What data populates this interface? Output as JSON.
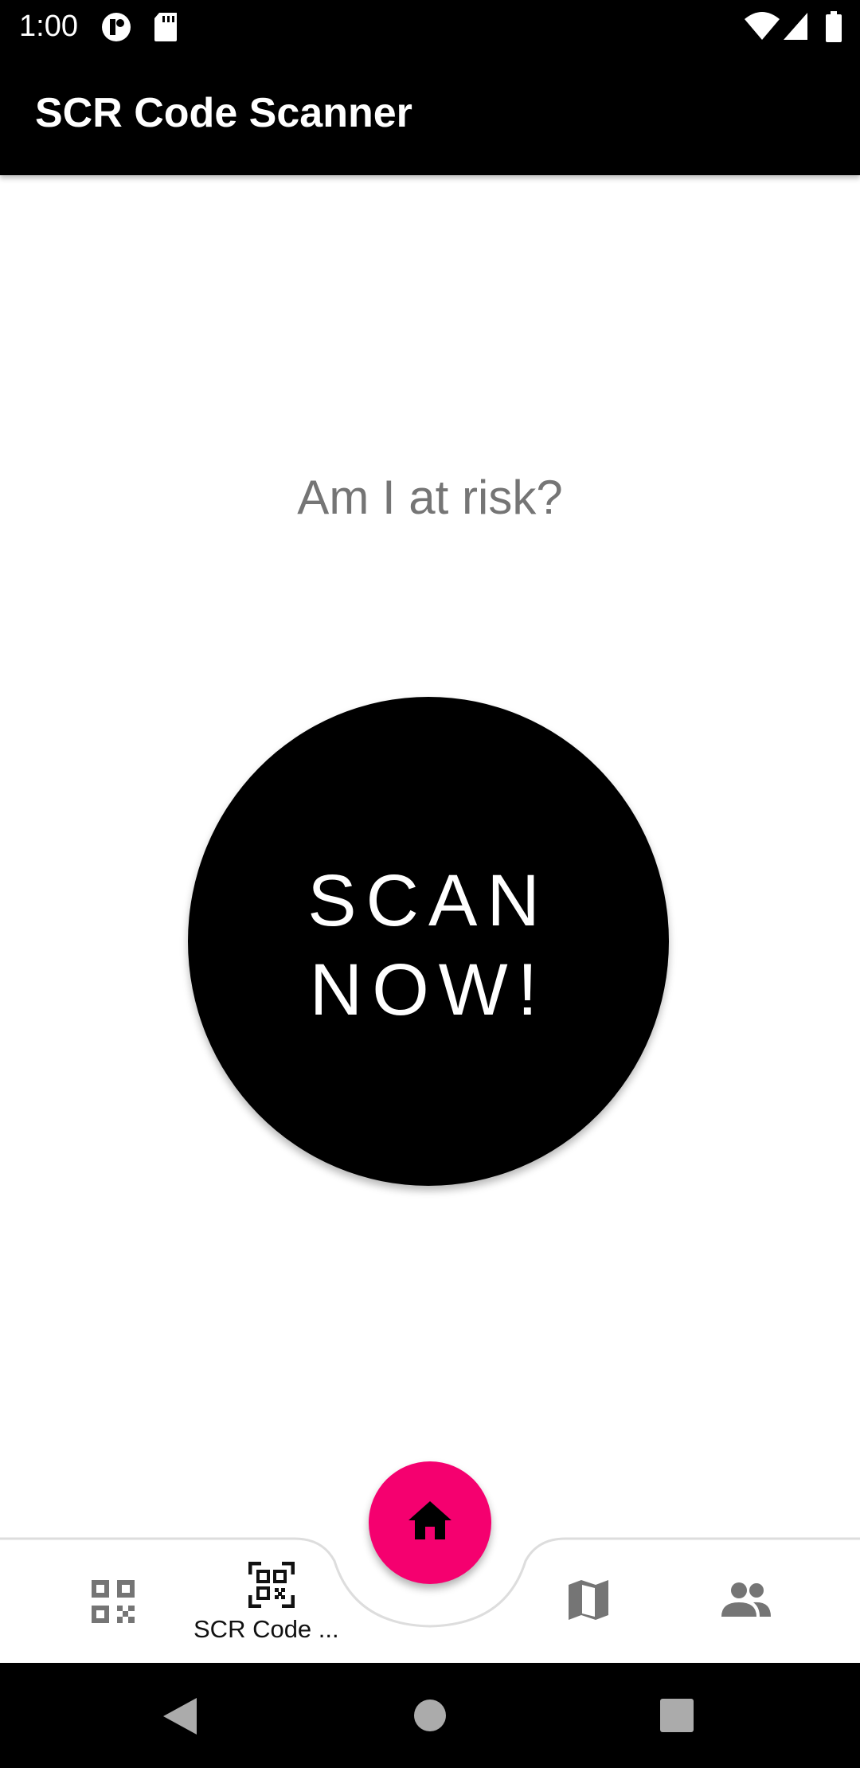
{
  "status_bar": {
    "time": "1:00",
    "icons": [
      "notification-app-icon",
      "sd-card-icon",
      "wifi-icon",
      "signal-icon",
      "battery-icon"
    ]
  },
  "app_bar": {
    "title": "SCR Code Scanner"
  },
  "main": {
    "question": "Am I at risk?",
    "scan_button": {
      "line1": "SCAN",
      "line2": "NOW!"
    }
  },
  "bottom_nav": {
    "items": [
      {
        "icon": "qr-code-icon",
        "label": ""
      },
      {
        "icon": "qr-scanner-icon",
        "label": "SCR Code ..."
      },
      {
        "icon": "map-icon",
        "label": ""
      },
      {
        "icon": "people-icon",
        "label": ""
      }
    ],
    "fab_icon": "home-icon",
    "fab_color": "#f5006f"
  },
  "system_nav": {
    "icons": [
      "back-icon",
      "home-circle-icon",
      "recents-icon"
    ]
  }
}
